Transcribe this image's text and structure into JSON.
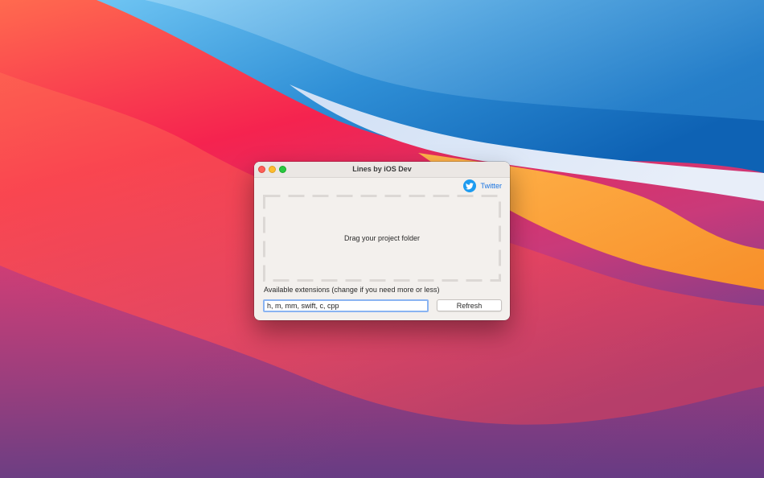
{
  "window": {
    "title": "Lines by iOS Dev"
  },
  "header": {
    "twitter_label": "Twitter",
    "twitter_icon": "twitter-bird-icon"
  },
  "dropzone": {
    "text": "Drag your project folder"
  },
  "extensions": {
    "label": "Available extensions (change if you need more or less)",
    "value": "h, m, mm, swift, c, cpp"
  },
  "actions": {
    "refresh_label": "Refresh"
  },
  "colors": {
    "window_background": "#f3f0ed",
    "accent_link": "#1a74e0",
    "twitter_brand": "#1d9bf0",
    "focus_ring": "#8ab4f2",
    "close_button": "#fe5f57",
    "minimize_button": "#febc2e",
    "zoom_button": "#28c840"
  }
}
